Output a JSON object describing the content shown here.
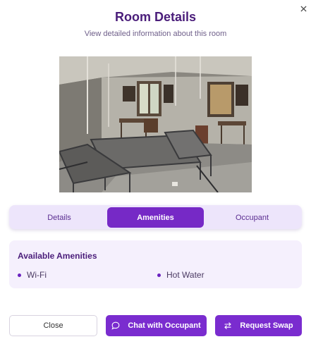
{
  "dialog": {
    "close_icon": "close-icon",
    "title": "Room Details",
    "subtitle": "View detailed information about this room"
  },
  "room_photo": {
    "content": "Room interior with metal bed frames, windows, desk and chairs"
  },
  "tabs": [
    {
      "label": "Details",
      "selected": false
    },
    {
      "label": "Amenities",
      "selected": true
    },
    {
      "label": "Occupant",
      "selected": false
    }
  ],
  "amenities": {
    "heading": "Available Amenities",
    "items": [
      "Wi-Fi",
      "Hot Water"
    ]
  },
  "footer": {
    "close_label": "Close",
    "chat_label": "Chat with Occupant",
    "chat_icon": "chat-bubble-icon",
    "swap_label": "Request Swap",
    "swap_icon": "swap-arrows-icon"
  },
  "colors": {
    "accent": "#7629c6",
    "title": "#4a1d7a",
    "tab_bg": "#ede5fb",
    "panel_bg": "#f5f0fd"
  }
}
